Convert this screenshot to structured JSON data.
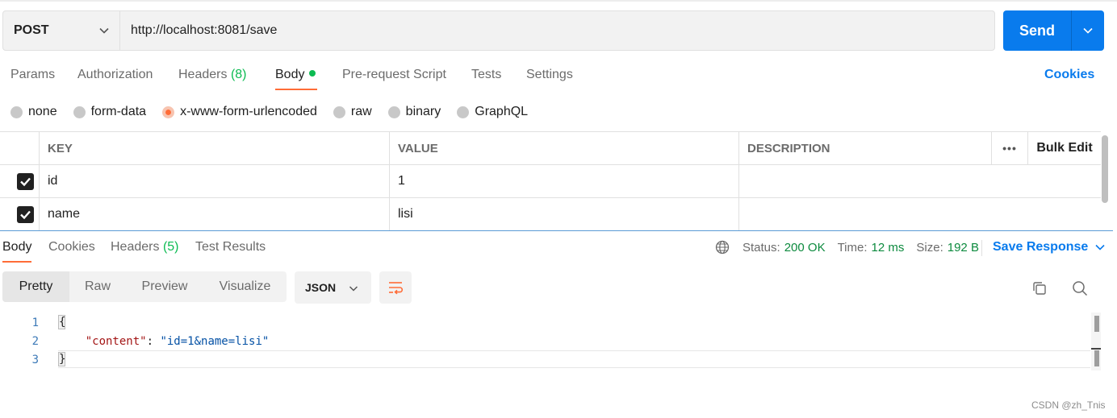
{
  "request": {
    "method": "POST",
    "url": "http://localhost:8081/save",
    "send_label": "Send"
  },
  "request_tabs": {
    "params": "Params",
    "authorization": "Authorization",
    "headers": "Headers",
    "headers_count": "(8)",
    "body": "Body",
    "prerequest": "Pre-request Script",
    "tests": "Tests",
    "settings": "Settings",
    "cookies": "Cookies"
  },
  "body_types": [
    "none",
    "form-data",
    "x-www-form-urlencoded",
    "raw",
    "binary",
    "GraphQL"
  ],
  "body_type_selected": "x-www-form-urlencoded",
  "params_table": {
    "headers": {
      "key": "KEY",
      "value": "VALUE",
      "description": "DESCRIPTION",
      "more": "•••",
      "bulk_edit": "Bulk Edit"
    },
    "rows": [
      {
        "checked": true,
        "key": "id",
        "value": "1",
        "description": ""
      },
      {
        "checked": true,
        "key": "name",
        "value": "lisi",
        "description": ""
      }
    ]
  },
  "response_tabs": {
    "body": "Body",
    "cookies": "Cookies",
    "headers": "Headers",
    "headers_count": "(5)",
    "test_results": "Test Results"
  },
  "response_status": {
    "status_label": "Status:",
    "status_value": "200 OK",
    "time_label": "Time:",
    "time_value": "12 ms",
    "size_label": "Size:",
    "size_value": "192 B",
    "save_response": "Save Response"
  },
  "view_modes": [
    "Pretty",
    "Raw",
    "Preview",
    "Visualize"
  ],
  "view_mode_selected": "Pretty",
  "format": "JSON",
  "code": {
    "line_numbers": [
      "1",
      "2",
      "3"
    ],
    "open_brace": "{",
    "key": "\"content\"",
    "colon": ": ",
    "value": "\"id=1&name=lisi\"",
    "close_brace": "}"
  },
  "watermark": "CSDN @zh_Tnis",
  "colors": {
    "accent": "#ff6c37",
    "send_button": "#097bed",
    "success": "#0cbb52"
  }
}
